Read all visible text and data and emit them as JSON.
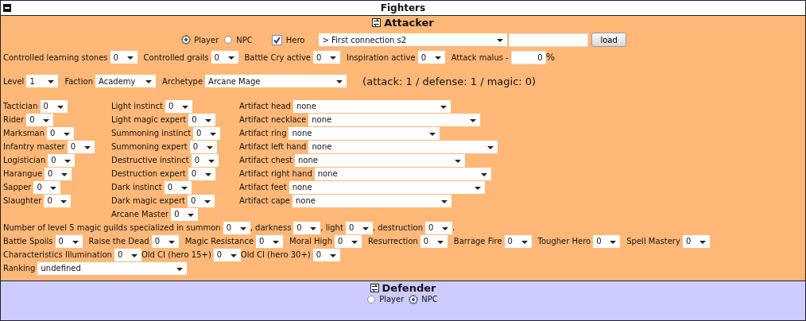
{
  "title": "Fighters",
  "attacker": {
    "title": "Attacker",
    "side": [
      {
        "label": "Player",
        "selected": true
      },
      {
        "label": "NPC",
        "selected": false
      }
    ],
    "hero": {
      "label": "Hero",
      "checked": true
    },
    "profile": {
      "value": "> First connection s2"
    },
    "load_button": "load",
    "stats": [
      {
        "label": "Controlled learning stones",
        "value": "0"
      },
      {
        "label": "Controlled grails",
        "value": "0"
      },
      {
        "label": "Battle Cry active",
        "value": "0"
      },
      {
        "label": "Inspiration active",
        "value": "0"
      }
    ],
    "attack_malus": {
      "label": "Attack malus -",
      "value": "0",
      "unit": "%"
    },
    "identity": [
      {
        "label": "Level",
        "value": "1"
      },
      {
        "label": "Faction",
        "value": "Academy"
      },
      {
        "label": "Archetype",
        "value": "Arcane Mage"
      }
    ],
    "summary": "(attack: 1 / defense: 1 / magic: 0)",
    "skills_1": [
      {
        "label": "Tactician",
        "value": "0"
      },
      {
        "label": "Rider",
        "value": "0"
      },
      {
        "label": "Marksman",
        "value": "0"
      },
      {
        "label": "Infantry master",
        "value": "0"
      },
      {
        "label": "Logistician",
        "value": "0"
      },
      {
        "label": "Harangue",
        "value": "0"
      },
      {
        "label": "Sapper",
        "value": "0"
      },
      {
        "label": "Slaughter",
        "value": "0"
      }
    ],
    "skills_2": [
      {
        "label": "Light instinct",
        "value": "0"
      },
      {
        "label": "Light magic expert",
        "value": "0"
      },
      {
        "label": "Summoning instinct",
        "value": "0"
      },
      {
        "label": "Summoning expert",
        "value": "0"
      },
      {
        "label": "Destructive instinct",
        "value": "0"
      },
      {
        "label": "Destruction expert",
        "value": "0"
      },
      {
        "label": "Dark instinct",
        "value": "0"
      },
      {
        "label": "Dark magic expert",
        "value": "0"
      },
      {
        "label": "Arcane Master",
        "value": "0"
      }
    ],
    "artifacts": [
      {
        "label": "Artifact head",
        "value": "none"
      },
      {
        "label": "Artifact necklace",
        "value": "none"
      },
      {
        "label": "Artifact ring",
        "value": "none"
      },
      {
        "label": "Artifact left hand",
        "value": "none"
      },
      {
        "label": "Artifact chest",
        "value": "none"
      },
      {
        "label": "Artifact right hand",
        "value": "none"
      },
      {
        "label": "Artifact feet",
        "value": "none"
      },
      {
        "label": "Artifact cape",
        "value": "none"
      }
    ],
    "guilds": [
      {
        "label": "Number of level 5 magic guilds specialized in summon",
        "value": "0"
      },
      {
        "label": ", darkness",
        "value": "0"
      },
      {
        "label": ", light",
        "value": "0"
      },
      {
        "label": ", destruction",
        "value": "0"
      }
    ],
    "guilds_end": ".",
    "abilities": [
      {
        "label": "Battle Spoils",
        "value": "0"
      },
      {
        "label": "Raise the Dead",
        "value": "0"
      },
      {
        "label": "Magic Resistance",
        "value": "0"
      },
      {
        "label": "Moral High",
        "value": "0"
      },
      {
        "label": "Resurrection",
        "value": "0"
      },
      {
        "label": "Barrage Fire",
        "value": "0"
      },
      {
        "label": "Tougher Hero",
        "value": "0"
      },
      {
        "label": "Spell Mastery",
        "value": "0"
      }
    ],
    "illumination": [
      {
        "label": "Characteristics Illumination",
        "value": "0"
      },
      {
        "label": "Old CI (hero 15+)",
        "value": "0"
      },
      {
        "label": "Old CI (hero 30+)",
        "value": "0"
      }
    ],
    "ranking": {
      "label": "Ranking",
      "value": "undefined"
    }
  },
  "defender": {
    "title": "Defender",
    "side": [
      {
        "label": "Player",
        "selected": false
      },
      {
        "label": "NPC",
        "selected": true
      }
    ]
  }
}
